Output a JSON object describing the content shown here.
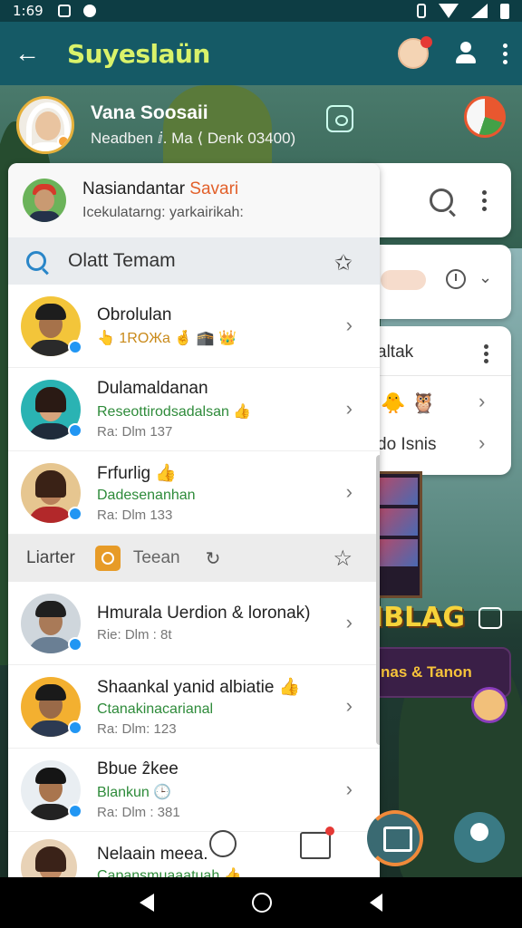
{
  "status_bar": {
    "time": "1:69"
  },
  "app_bar": {
    "title": "Suyeslaün"
  },
  "profile": {
    "name": "Vana Soosaii",
    "subtitle": "Neadben ⅈ. Ma ⟨ Denk 03400)"
  },
  "me": {
    "name_main": "Nasiandantar ",
    "name_accent": "Savari",
    "subtitle": "Icekulatarng: yarkairikah:"
  },
  "section": {
    "title": "Olatt Temam"
  },
  "rows_top": [
    {
      "name": "Obrolulan",
      "emoji": "👆 1ROЖa 🤞 🕋 👑"
    },
    {
      "name": "Dulamaldanan",
      "sub": "Reseottirodsadalsan 👍",
      "meta": "Ra: Dlm 137"
    },
    {
      "name": "Frfurlig 👍",
      "sub": "Dadesenanhan",
      "meta": "Ra: Dlm 133"
    }
  ],
  "sub_head": {
    "label_1": "Liarter",
    "label_2": "Teean"
  },
  "rows_bottom": [
    {
      "name": "Hmurala Uerdion & loronak)",
      "meta": "Rie: Dlm : 8t"
    },
    {
      "name": "Shaankal yanid albiatie 👍",
      "sub": "Ctanakinacarianal",
      "meta": "Ra: Dlm: 123"
    },
    {
      "name": "Bbue ẑkee",
      "sub": "Blankun 🕒",
      "meta": "Ra: Dlm : 381"
    }
  ],
  "peek_row": {
    "name": "Nelaain meea.",
    "sub": "Capansmuaaatuah 👍"
  },
  "right_cards": {
    "card3_title": "altak",
    "card3_label": "do Isnis"
  },
  "game": {
    "logo": "IBLAG",
    "banner": "nas & Tanon"
  },
  "colors": {
    "app_bar": "#155a66",
    "title_accent": "#d9f26a",
    "verified_badge": "#2196f3",
    "sub_text_green": "#2e8b3a",
    "name_accent": "#e2602a"
  }
}
